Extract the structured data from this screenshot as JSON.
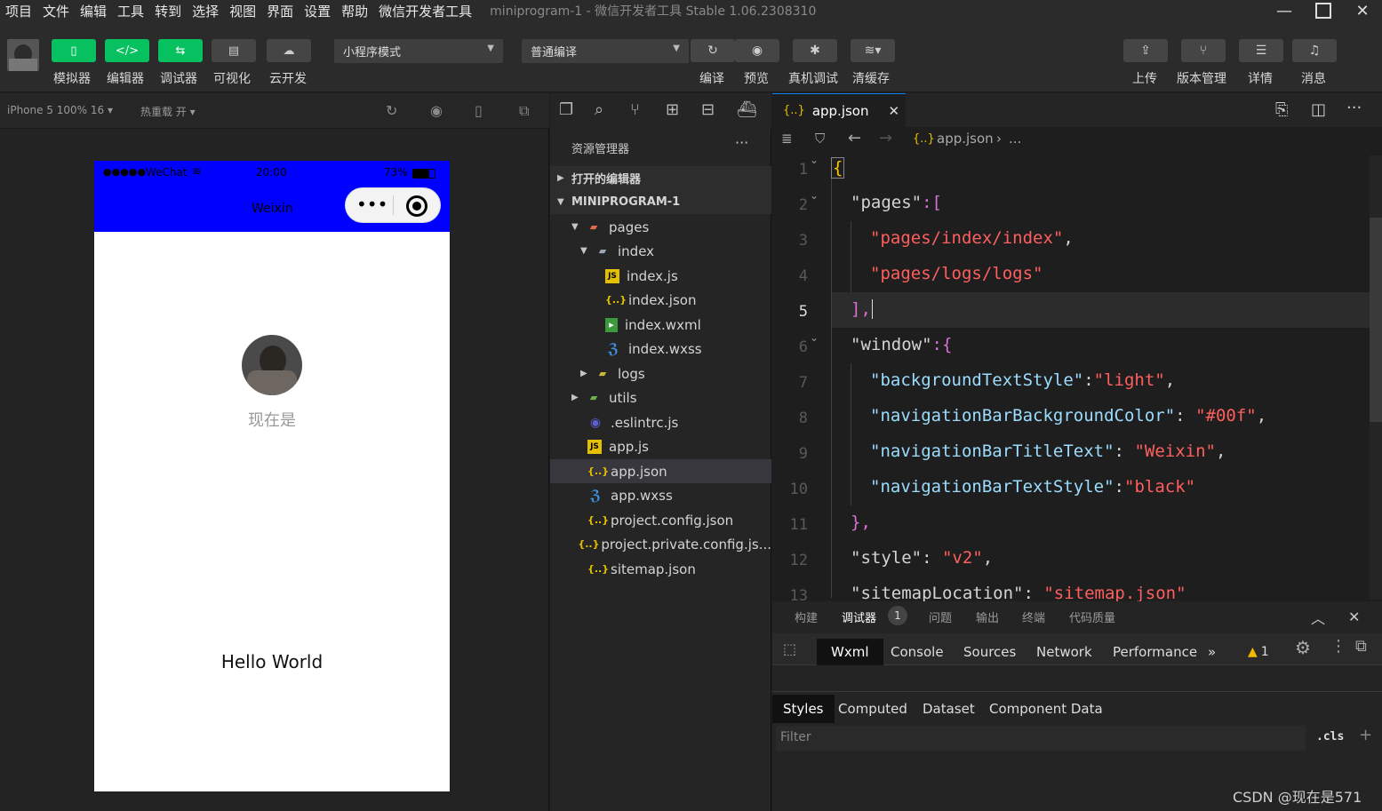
{
  "menu": [
    "项目",
    "文件",
    "编辑",
    "工具",
    "转到",
    "选择",
    "视图",
    "界面",
    "设置",
    "帮助",
    "微信开发者工具"
  ],
  "window_title": "miniprogram-1 - 微信开发者工具 Stable 1.06.2308310",
  "toolbar": {
    "simulator": "模拟器",
    "editor": "编辑器",
    "debugger": "调试器",
    "visual": "可视化",
    "cloud": "云开发",
    "mode_select": "小程序模式",
    "compile_select": "普通编译",
    "compile": "编译",
    "preview": "预览",
    "real_debug": "真机调试",
    "clear_cache": "清缓存",
    "upload": "上传",
    "version": "版本管理",
    "details": "详情",
    "messages": "消息"
  },
  "simbar": {
    "device": "iPhone 5 100% 16",
    "hotreload": "热重载 开"
  },
  "phone": {
    "signal": "●●●●●",
    "carrier": "WeChat",
    "time": "20:00",
    "battery": "73%",
    "nav_title": "Weixin",
    "nickname": "现在是",
    "hello": "Hello World",
    "nav_bg": "#0000ff"
  },
  "explorer": {
    "title": "资源管理器",
    "open_editors": "打开的编辑器",
    "project": "MINIPROGRAM-1",
    "files": {
      "pages": "pages",
      "index": "index",
      "index_js": "index.js",
      "index_json": "index.json",
      "index_wxml": "index.wxml",
      "index_wxss": "index.wxss",
      "logs": "logs",
      "utils": "utils",
      "eslintrc": ".eslintrc.js",
      "app_js": "app.js",
      "app_json": "app.json",
      "app_wxss": "app.wxss",
      "project_config": "project.config.json",
      "project_private": "project.private.config.js...",
      "sitemap": "sitemap.json"
    }
  },
  "editor": {
    "tab": "app.json",
    "breadcrumb": "app.json",
    "breadcrumb_more": "...",
    "line_numbers": [
      "1",
      "2",
      "3",
      "4",
      "5",
      "6",
      "7",
      "8",
      "9",
      "10",
      "11",
      "12",
      "13"
    ],
    "code": {
      "l1": "{",
      "l2_key": "\"pages\"",
      "l2_rest": ":[",
      "l3": "\"pages/index/index\"",
      "l4": "\"pages/logs/logs\"",
      "l5": "],",
      "l6_key": "\"window\"",
      "l6_rest": ":{",
      "l7_key": "\"backgroundTextStyle\"",
      "l7_val": "\"light\"",
      "l8_key": "\"navigationBarBackgroundColor\"",
      "l8_val": "\"#00f\"",
      "l9_key": "\"navigationBarTitleText\"",
      "l9_val": "\"Weixin\"",
      "l10_key": "\"navigationBarTextStyle\"",
      "l10_val": "\"black\"",
      "l11": "},",
      "l12_key": "\"style\"",
      "l12_val": "\"v2\"",
      "l13_key": "\"sitemapLocation\"",
      "l13_val": "\"sitemap.json\""
    }
  },
  "panel": {
    "tabs": [
      "构建",
      "调试器",
      "问题",
      "输出",
      "终端",
      "代码质量"
    ],
    "debugger_badge": "1",
    "devtools_tabs": [
      "Wxml",
      "Console",
      "Sources",
      "Network",
      "Performance"
    ],
    "more": "»",
    "warning_count": "1",
    "style_tabs": [
      "Styles",
      "Computed",
      "Dataset",
      "Component Data"
    ],
    "filter_placeholder": "Filter",
    "cls": ".cls",
    "plus": "+"
  },
  "watermark": "CSDN @现在是571"
}
